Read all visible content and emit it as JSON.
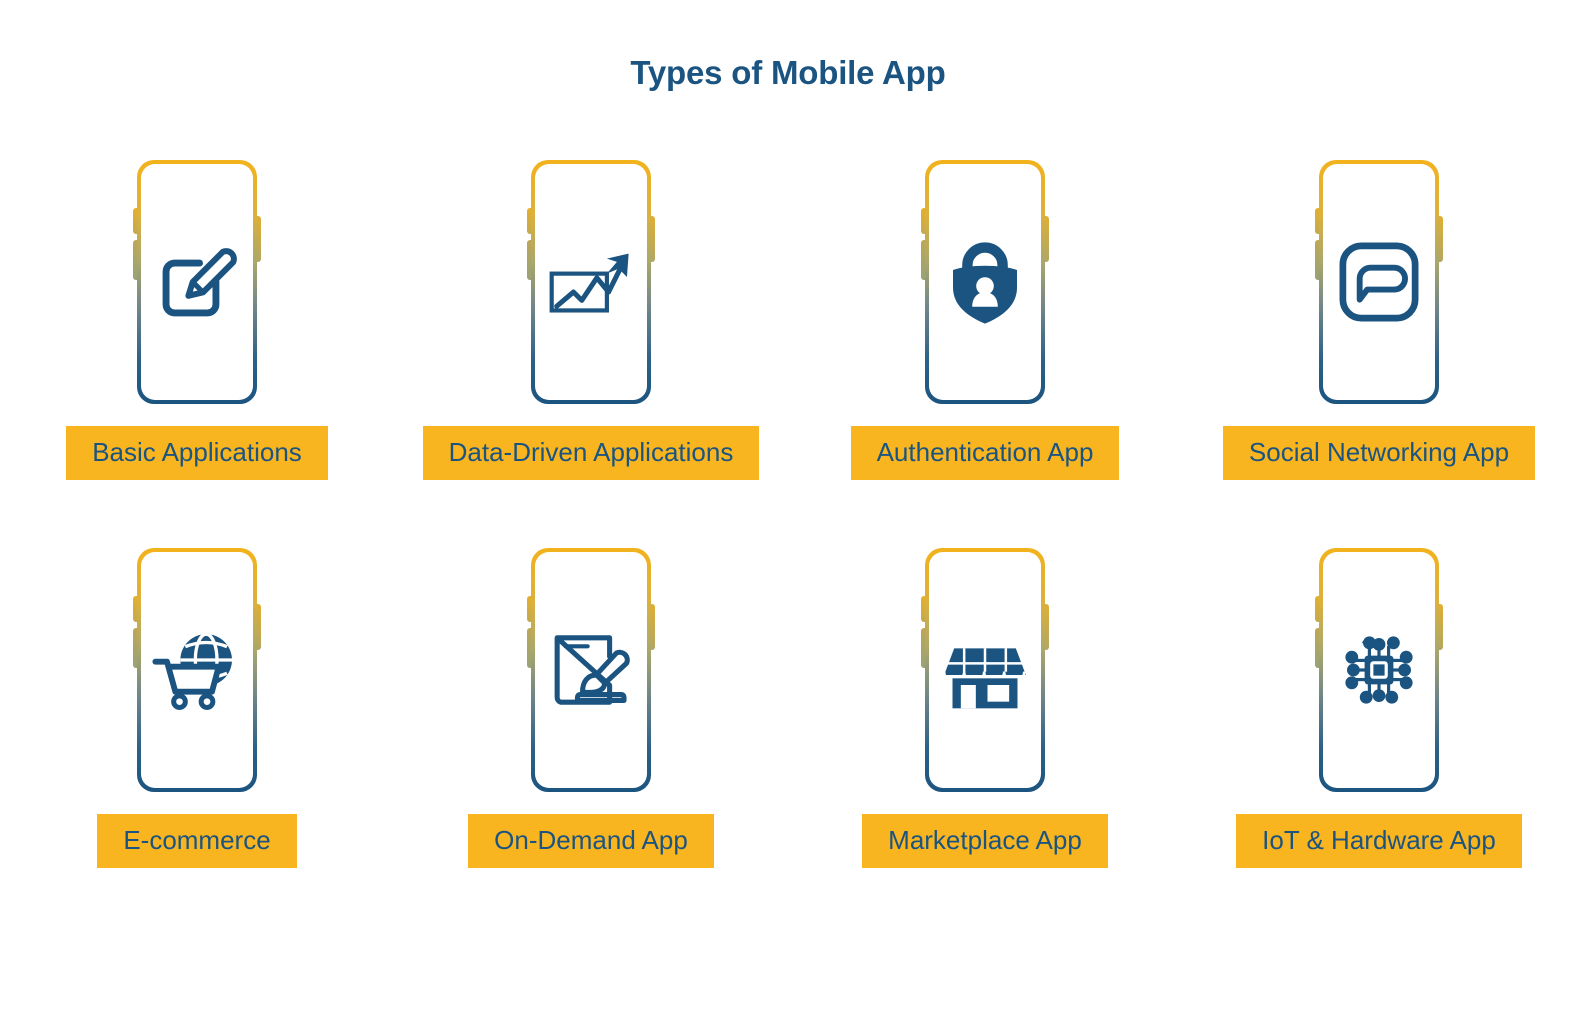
{
  "header": {
    "title": "Types of Mobile App"
  },
  "colors": {
    "amber": "#F9B51F",
    "navy": "#1B5480",
    "background": "#FFFFFF"
  },
  "grid": {
    "rows": [
      {
        "cells": [
          {
            "label": "Basic Applications",
            "icon": "edit-pencil-square-icon"
          },
          {
            "label": "Data-Driven Applications",
            "icon": "growth-chart-arrow-icon"
          },
          {
            "label": "Authentication App",
            "icon": "shield-lock-user-icon"
          },
          {
            "label": "Social Networking App",
            "icon": "chat-bubble-square-icon"
          }
        ]
      },
      {
        "cells": [
          {
            "label": "E-commerce",
            "icon": "globe-shopping-cart-icon"
          },
          {
            "label": "On-Demand App",
            "icon": "document-paintbrush-icon"
          },
          {
            "label": "Marketplace App",
            "icon": "storefront-awning-icon"
          },
          {
            "label": "IoT & Hardware App",
            "icon": "microchip-circuit-icon"
          }
        ]
      }
    ]
  }
}
